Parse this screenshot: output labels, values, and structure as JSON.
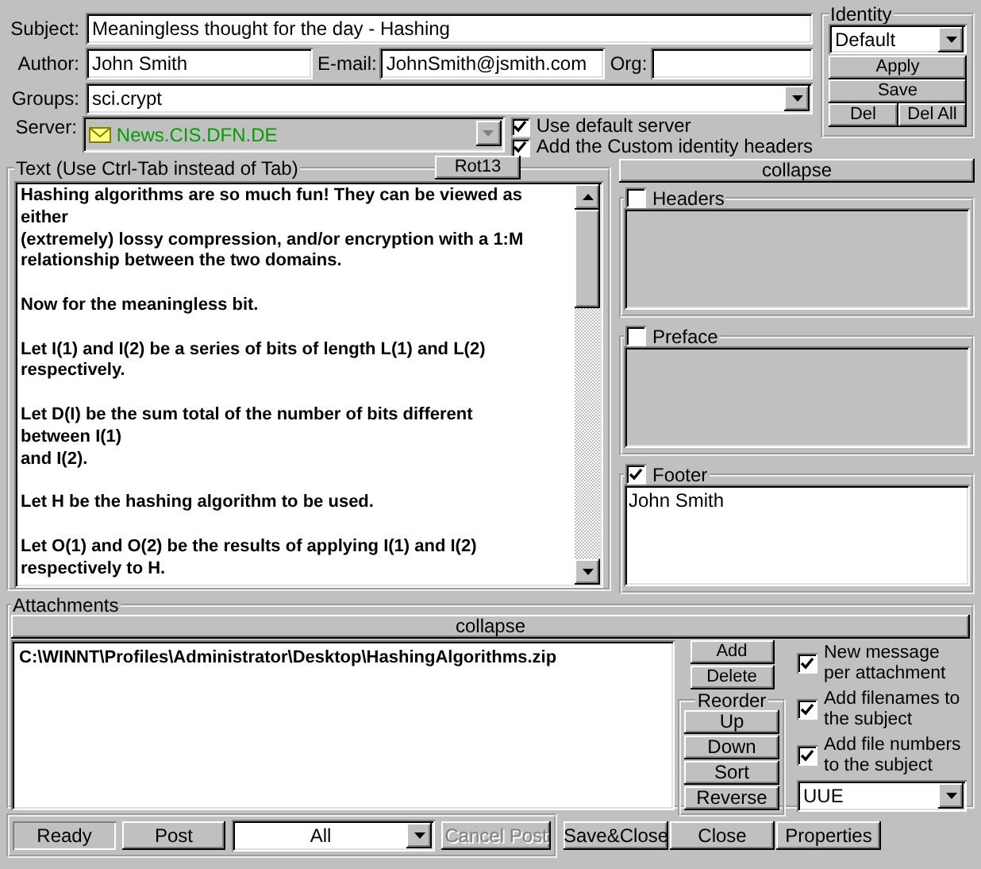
{
  "header": {
    "subject_label": "Subject:",
    "subject": "Meaningless thought for the day - Hashing",
    "author_label": "Author:",
    "author": "John Smith",
    "email_label": "E-mail:",
    "email": "JohnSmith@jsmith.com",
    "org_label": "Org:",
    "groups_label": "Groups:",
    "groups": "sci.crypt",
    "server_label": "Server:",
    "server": {
      "value": "News.CIS.DFN.DE",
      "disabled": true
    },
    "options": [
      {
        "label": "Use default server",
        "checked": true
      },
      {
        "label": "Add the Custom identity headers",
        "checked": true
      }
    ]
  },
  "identity": {
    "title": "Identity",
    "profile": "Default",
    "buttons": [
      "Apply",
      "Save"
    ],
    "delete_buttons": [
      "Del",
      "Del All"
    ]
  },
  "text_group": {
    "title": "Text  (Use Ctrl-Tab instead of Tab)",
    "rot13_button": "Rot13",
    "paragraphs": [
      [
        "Hashing algorithms are so much fun! They can be viewed as",
        "either",
        "(extremely) lossy compression, and/or encryption with a 1:M",
        "relationship between the two domains."
      ],
      [
        "Now for the meaningless bit."
      ],
      [
        "Let I(1) and I(2) be a series of bits of length L(1) and L(2)",
        "respectively."
      ],
      [
        "Let D(I) be the sum total of the number of bits different",
        "between I(1)",
        "and I(2)."
      ],
      [
        "Let H be the hashing algorithm to be used."
      ],
      [
        "Let O(1) and O(2) be the results of applying I(1) and I(2)",
        "respectively to H."
      ]
    ]
  },
  "side_panel": {
    "collapse_button": "collapse",
    "sections": [
      {
        "title": "Headers",
        "checked": false
      },
      {
        "title": "Preface",
        "checked": false
      },
      {
        "title": "Footer",
        "checked": true,
        "content": [
          "John Smith"
        ]
      }
    ]
  },
  "attachments": {
    "title": "Attachments",
    "collapse_button": "collapse",
    "files": [
      "C:\\WINNT\\Profiles\\Administrator\\Desktop\\HashingAlgorithms.zip"
    ],
    "buttons": [
      "Add",
      "Delete"
    ],
    "reorder": {
      "title": "Reorder",
      "buttons": [
        "Up",
        "Down",
        "Sort",
        "Reverse"
      ]
    },
    "options": [
      {
        "label": "New message per attachment",
        "checked": true
      },
      {
        "label": "Add filenames to the subject",
        "checked": true
      },
      {
        "label": "Add file numbers to the subject",
        "checked": true
      }
    ],
    "encoding": "UUE"
  },
  "status_bar": {
    "status": "Ready",
    "post_button": "Post",
    "filter": "All",
    "cancel_button": {
      "label": "Cancel Post",
      "disabled": true
    },
    "buttons": [
      "Save&Close",
      "Close",
      "Properties"
    ]
  }
}
